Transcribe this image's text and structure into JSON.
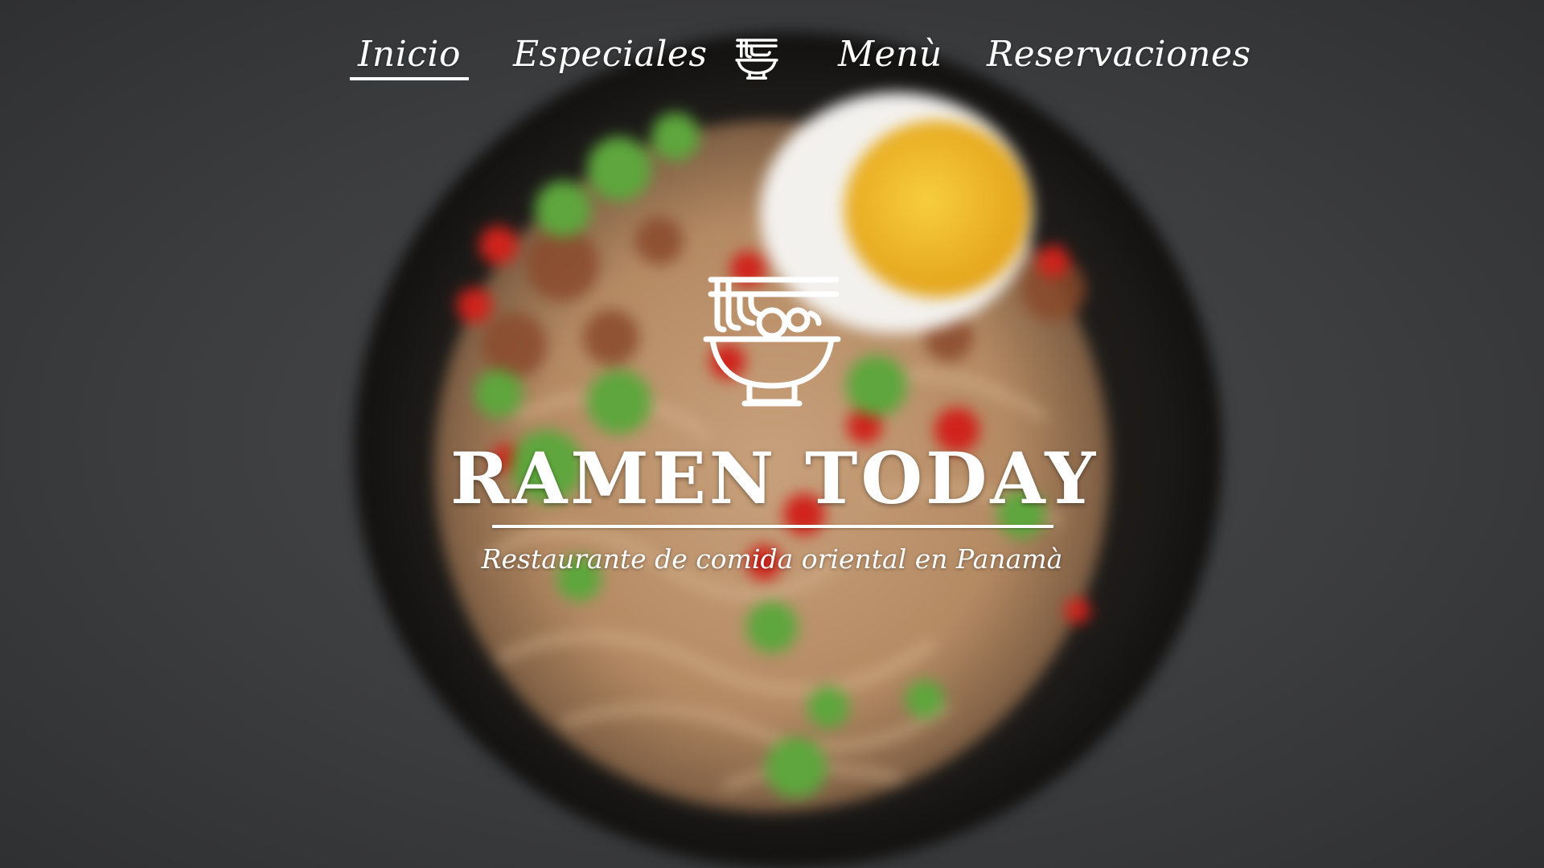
{
  "nav": {
    "items": [
      {
        "label": "Inicio",
        "active": true
      },
      {
        "label": "Especiales",
        "active": false
      },
      {
        "label": "Menù",
        "active": false
      },
      {
        "label": "Reservaciones",
        "active": false
      }
    ],
    "logo_icon": "ramen-bowl-icon"
  },
  "hero": {
    "logo_icon": "ramen-bowl-icon",
    "title": "RAMEN TODAY",
    "subtitle": "Restaurante de comida oriental en Panamà",
    "background": "blurred-ramen-bowl-photo"
  },
  "colors": {
    "text": "#ffffff",
    "background": "#3c3d3f",
    "bowl": "#1b1a19",
    "noodle": "#c9a27a",
    "egg_yolk": "#f2b825",
    "egg_white": "#f4f2ef",
    "chili": "#d0221c",
    "scallion": "#5aa33a"
  }
}
